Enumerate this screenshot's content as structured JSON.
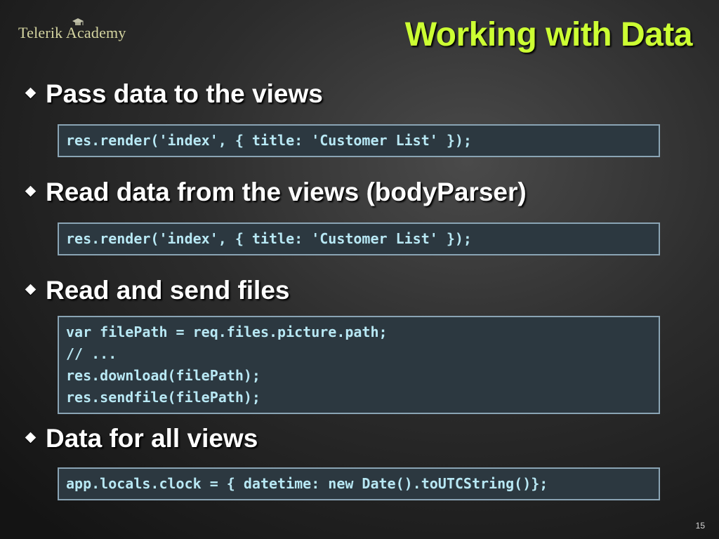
{
  "logo": {
    "text": "Telerik Academy",
    "icon": "graduation-cap-icon"
  },
  "title": "Working with Data",
  "sections": [
    {
      "bullet": "Pass data to the views",
      "code": [
        "res.render('index', { title: 'Customer List' });"
      ]
    },
    {
      "bullet": "Read data from the views (bodyParser)",
      "code": [
        "res.render('index', { title: 'Customer List' });"
      ]
    },
    {
      "bullet": "Read and send files",
      "code": [
        "var filePath = req.files.picture.path;",
        "// ...",
        "res.download(filePath);",
        "res.sendfile(filePath);"
      ]
    },
    {
      "bullet": "Data for all views",
      "code": [
        "app.locals.clock = { datetime: new Date().toUTCString()};"
      ]
    }
  ],
  "page_number": "15",
  "colors": {
    "title": "#ccff33",
    "code_text": "#b8e8f4",
    "code_background": "#2c3840",
    "code_border": "#8aa4b4",
    "logo": "#d4d4a0"
  }
}
